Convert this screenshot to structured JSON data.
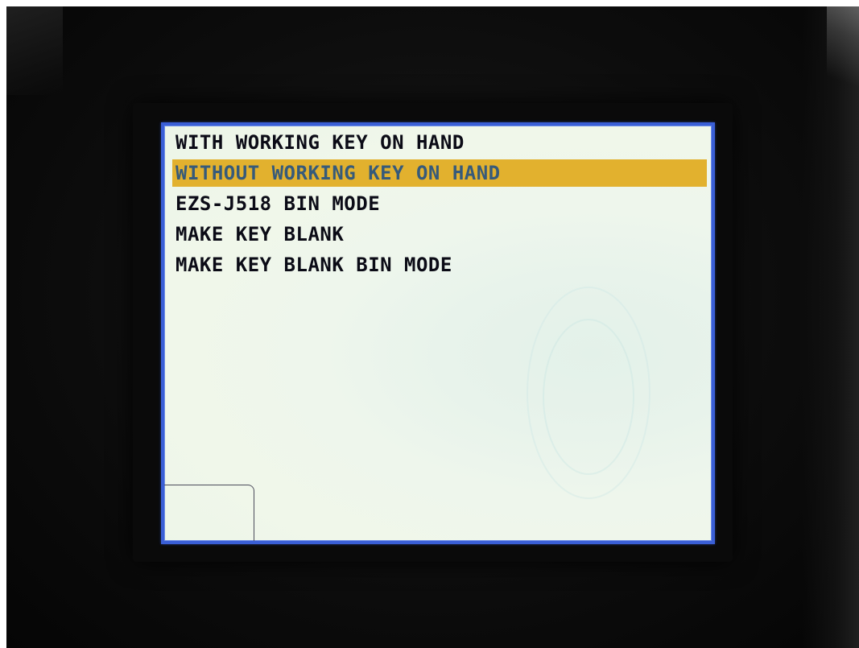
{
  "screen": {
    "menu": {
      "items": [
        {
          "label": "WITH WORKING KEY ON HAND",
          "selected": false
        },
        {
          "label": "WITHOUT WORKING KEY ON HAND",
          "selected": true
        },
        {
          "label": "EZS-J518 BIN MODE",
          "selected": false
        },
        {
          "label": "MAKE KEY BLANK",
          "selected": false
        },
        {
          "label": "MAKE KEY BLANK BIN MODE",
          "selected": false
        }
      ]
    }
  },
  "colors": {
    "highlight": "#e2b12e",
    "highlight_text": "#365a7a",
    "menu_text": "#0b0b16",
    "screen_bg": "#eef6ec",
    "screen_border": "#3a5fd6",
    "housing": "#0d0d0d"
  }
}
